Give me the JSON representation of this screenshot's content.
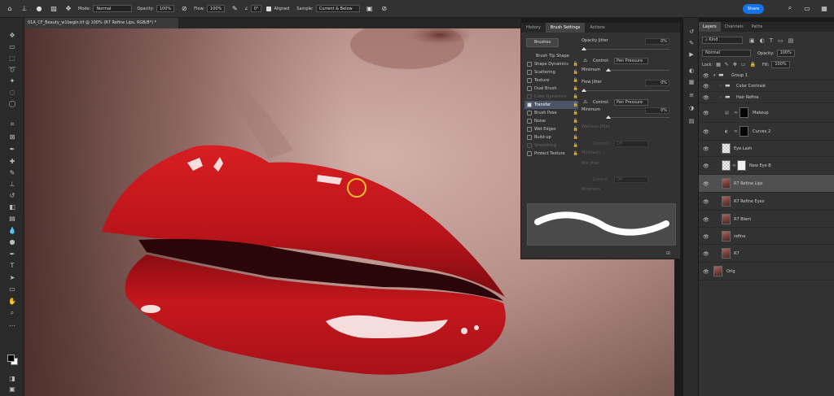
{
  "options_bar": {
    "mode_label": "Mode:",
    "mode_value": "Normal",
    "opacity_label": "Opacity:",
    "opacity_value": "100%",
    "flow_label": "Flow:",
    "flow_value": "100%",
    "angle_value": "0°",
    "aligned_label": "Aligned",
    "sample_label": "Sample:",
    "sample_value": "Current & Below",
    "share_label": "Share"
  },
  "document": {
    "tab_title": "01A_CF_Beauty_w1begin.tif @ 100% (R7 Refine Lips, RGB/8*) *"
  },
  "brush_panel": {
    "tabs": [
      "History",
      "Brush Settings",
      "Actions"
    ],
    "active_tab_index": 1,
    "brushes_button": "Brushes",
    "list_header": "Brush Tip Shape",
    "items": [
      {
        "label": "Shape Dynamics",
        "checked": false,
        "dim": false
      },
      {
        "label": "Scattering",
        "checked": false,
        "dim": false
      },
      {
        "label": "Texture",
        "checked": false,
        "dim": false
      },
      {
        "label": "Dual Brush",
        "checked": false,
        "dim": false
      },
      {
        "label": "Color Dynamics",
        "checked": false,
        "dim": true
      },
      {
        "label": "Transfer",
        "checked": true,
        "dim": false,
        "selected": true
      },
      {
        "label": "Brush Pose",
        "checked": false,
        "dim": false
      },
      {
        "label": "Noise",
        "checked": false,
        "dim": false
      },
      {
        "label": "Wet Edges",
        "checked": false,
        "dim": false
      },
      {
        "label": "Build-up",
        "checked": false,
        "dim": false
      },
      {
        "label": "Smoothing",
        "checked": false,
        "dim": true
      },
      {
        "label": "Protect Texture",
        "checked": false,
        "dim": false
      }
    ],
    "opacity_jitter_label": "Opacity Jitter",
    "opacity_jitter_value": "0%",
    "control_label": "Control:",
    "control_value": "Pen Pressure",
    "minimum_label": "Minimum",
    "minimum_value": "0%",
    "flow_jitter_label": "Flow Jitter",
    "flow_jitter_value": "0%",
    "control2_value": "Pen Pressure",
    "minimum2_value": "0%",
    "wetness_jitter_label": "Wetness Jitter",
    "control3_value": "Off",
    "minimum3_label": "Minimum",
    "mix_jitter_label": "Mix Jitter",
    "control4_value": "Off",
    "minimum4_label": "Minimum"
  },
  "layers_panel": {
    "tabs": [
      "Layers",
      "Channels",
      "Paths"
    ],
    "active_tab_index": 0,
    "filter_value": "Kind",
    "blend_value": "Normal",
    "opacity_label": "Opacity:",
    "opacity_value": "100%",
    "lock_label": "Lock:",
    "fill_label": "Fill:",
    "fill_value": "100%",
    "layers": [
      {
        "name": "Group 1",
        "type": "group",
        "indent": 0
      },
      {
        "name": "Color Contrast",
        "type": "group",
        "indent": 1
      },
      {
        "name": "Hair Refine",
        "type": "group",
        "indent": 1
      },
      {
        "name": "Makeup",
        "type": "adjust",
        "indent": 1
      },
      {
        "name": "Curves 2",
        "type": "adjust",
        "indent": 1
      },
      {
        "name": "Eye Lash",
        "type": "transparent",
        "indent": 0
      },
      {
        "name": "New Eye B",
        "type": "transparent-mask",
        "indent": 0
      },
      {
        "name": "R7 Refine Lips",
        "type": "face",
        "indent": 0,
        "selected": true
      },
      {
        "name": "R7 Refine Eyes",
        "type": "face",
        "indent": 0
      },
      {
        "name": "R7 Blem",
        "type": "face",
        "indent": 0
      },
      {
        "name": "refine",
        "type": "face",
        "indent": 0
      },
      {
        "name": "R7",
        "type": "face",
        "indent": 0
      },
      {
        "name": "Orig",
        "type": "face",
        "indent": -1
      }
    ]
  },
  "colors": {
    "accent": "#1473e6",
    "lip_red": "#c4181c",
    "brush_cursor": "#f2c02e"
  }
}
